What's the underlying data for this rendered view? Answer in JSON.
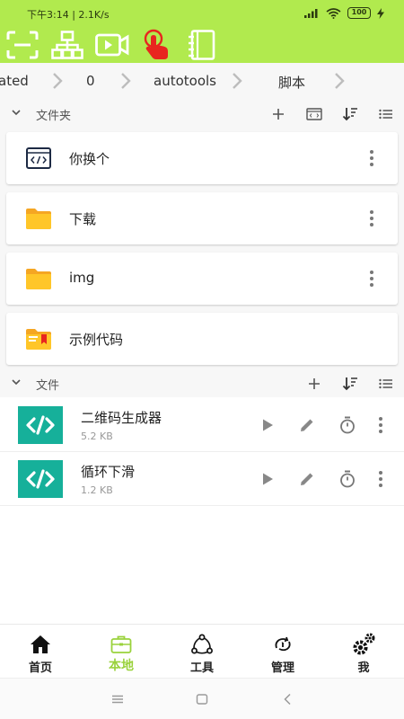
{
  "status_bar": {
    "time": "下午3:14",
    "speed": "2.1K/s",
    "battery": "100"
  },
  "toolbar": {
    "icons": [
      "scan-icon",
      "sitemap-icon",
      "video-record-icon",
      "touch-icon",
      "notebook-icon"
    ]
  },
  "breadcrumb": [
    "ated",
    "0",
    "autotools",
    "脚本"
  ],
  "folders_section": {
    "title": "文件夹"
  },
  "folders": [
    {
      "label": "你换个",
      "icon": "code-window-icon"
    },
    {
      "label": "下载",
      "icon": "folder-icon"
    },
    {
      "label": "img",
      "icon": "folder-icon"
    },
    {
      "label": "示例代码",
      "icon": "bookmarked-folder-icon"
    }
  ],
  "files_section": {
    "title": "文件"
  },
  "files": [
    {
      "name": "二维码生成器",
      "size": "5.2 KB"
    },
    {
      "name": "循环下滑",
      "size": "1.2 KB"
    }
  ],
  "bottom_nav": [
    {
      "label": "首页",
      "icon": "home-icon"
    },
    {
      "label": "本地",
      "icon": "briefcase-icon",
      "active": true
    },
    {
      "label": "工具",
      "icon": "share-nodes-icon"
    },
    {
      "label": "管理",
      "icon": "manage-icon"
    },
    {
      "label": "我",
      "icon": "gears-icon"
    }
  ],
  "colors": {
    "accent": "#b1ea4e",
    "active_tab": "#9ad23c",
    "file_icon": "#16b09a",
    "folder": "#ffc629",
    "touch_icon": "#e8251f"
  }
}
